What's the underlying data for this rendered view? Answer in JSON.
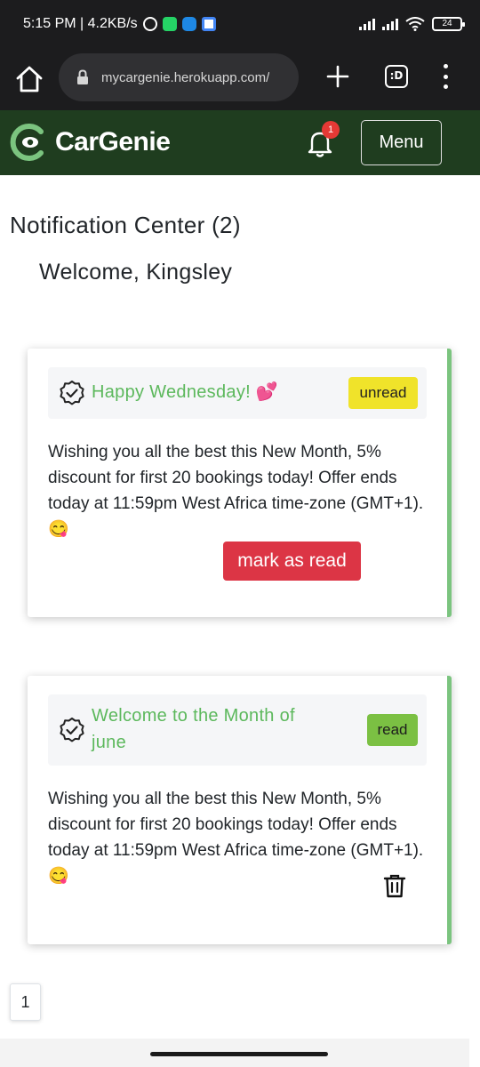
{
  "status_bar": {
    "left_text": "5:15 PM | 4.2KB/s",
    "battery": "24"
  },
  "browser": {
    "url": "mycargenie.herokuapp.com/",
    "tabs_label": ":D"
  },
  "navbar": {
    "brand": "CarGenie",
    "notification_count": "1",
    "menu_label": "Menu",
    "brand_color": "#1f3d1f"
  },
  "page": {
    "title": "Notification Center (2)",
    "welcome": "Welcome, Kingsley"
  },
  "notifications": [
    {
      "title": "Happy Wednesday! 💕",
      "status": "unread",
      "body": "Wishing you all the best this New Month, 5% discount for first 20 bookings today! Offer ends today at 11:59pm West Africa time-zone (GMT+1). 😋",
      "action_label": "mark as read"
    },
    {
      "title": "Welcome to the Month of june",
      "status": "read",
      "body": "Wishing you all the best this New Month, 5% discount for first 20 bookings today! Offer ends today at 11:59pm West Africa time-zone (GMT+1). 😋",
      "action_icon": "trash-icon"
    }
  ],
  "pagination": {
    "current_page": "1"
  },
  "colors": {
    "accent_green": "#5cb85c",
    "unread_badge": "#f0e32a",
    "read_badge": "#7bc043",
    "danger": "#dc3545"
  }
}
